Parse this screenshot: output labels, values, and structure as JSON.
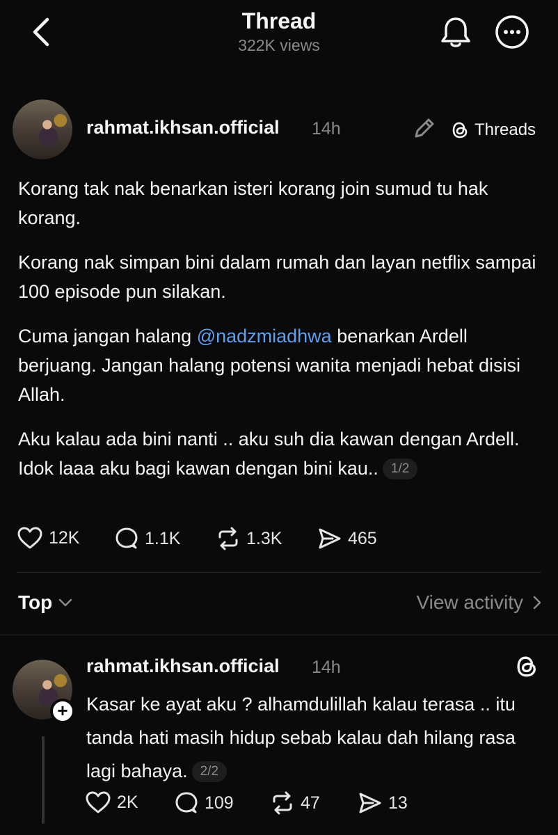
{
  "header": {
    "title": "Thread",
    "subtitle": "322K views"
  },
  "post": {
    "username": "rahmat.ikhsan.official",
    "time": "14h",
    "threads_label": "Threads",
    "paragraphs": {
      "p1": "Korang tak nak benarkan isteri korang join sumud tu hak korang.",
      "p2": "Korang nak simpan bini dalam rumah dan layan netflix sampai 100 episode pun silakan.",
      "p3_before": "Cuma jangan halang ",
      "p3_mention": "@nadzmiadhwa",
      "p3_after": " benarkan Ardell berjuang. Jangan halang potensi wanita menjadi hebat disisi Allah.",
      "p4": "Aku kalau ada bini nanti .. aku suh dia kawan dengan Ardell. Idok laaa aku bagi kawan dengan bini kau.."
    },
    "page": "1/2",
    "likes": "12K",
    "replies": "1.1K",
    "reposts": "1.3K",
    "shares": "465"
  },
  "sort": {
    "label": "Top",
    "activity": "View activity"
  },
  "reply": {
    "username": "rahmat.ikhsan.official",
    "time": "14h",
    "text": "Kasar ke ayat aku ? alhamdulillah kalau terasa .. itu tanda hati masih hidup sebab kalau dah hilang rasa lagi bahaya.",
    "page": "2/2",
    "likes": "2K",
    "replies": "109",
    "reposts": "47",
    "shares": "13"
  },
  "icons": {
    "back": "chevron-left-icon",
    "bell": "bell-icon",
    "more": "more-icon",
    "edit": "pencil-icon",
    "threads": "threads-logo-icon",
    "like": "heart-icon",
    "reply": "speech-bubble-icon",
    "repost": "repost-icon",
    "share": "send-icon"
  },
  "colors": {
    "background": "#0a0a0a",
    "mention": "#5ca0ef",
    "muted": "#8a8a8a"
  }
}
